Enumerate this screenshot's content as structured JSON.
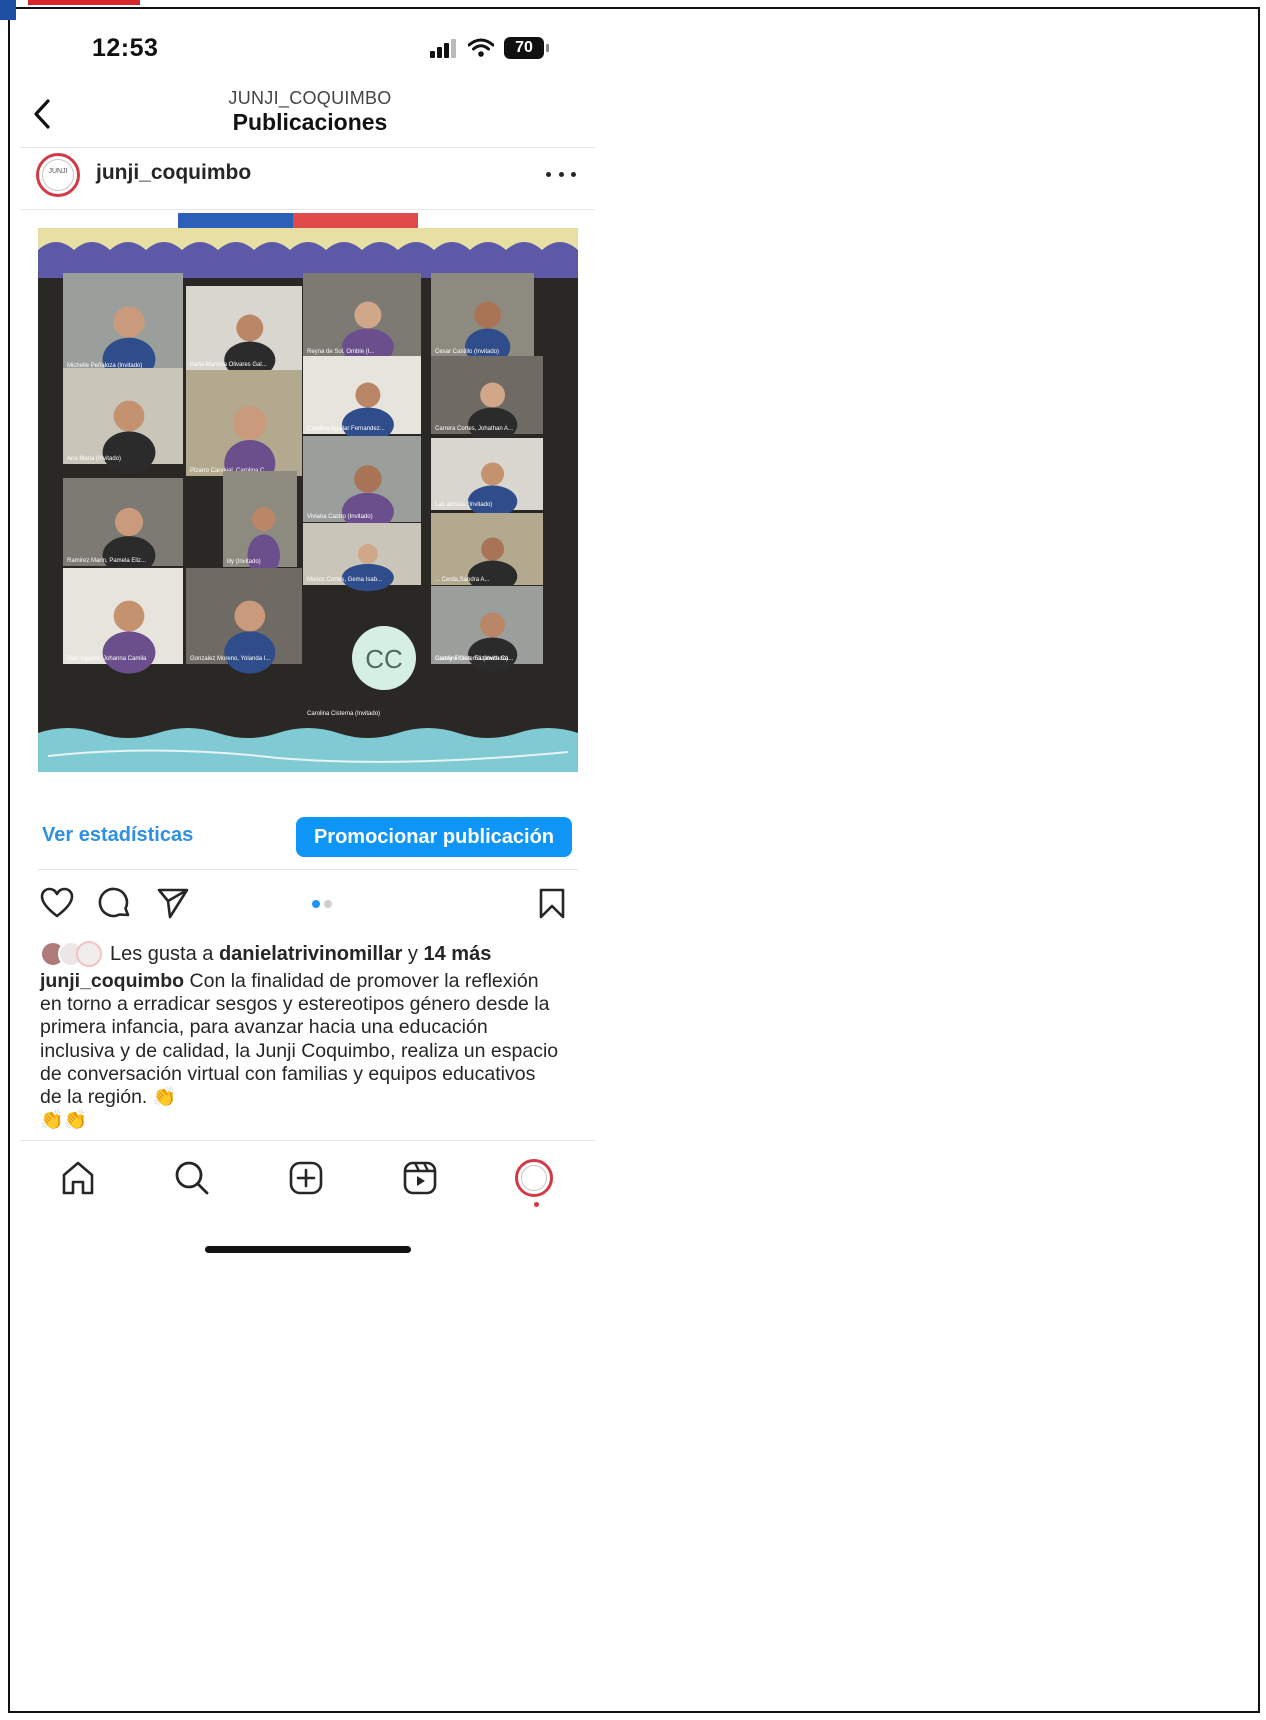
{
  "status_bar": {
    "time": "12:53",
    "battery": "70"
  },
  "header": {
    "account_caps": "JUNJI_COQUIMBO",
    "title": "Publicaciones"
  },
  "post": {
    "avatar_text": "JUNJI",
    "username": "junji_coquimbo",
    "image": {
      "participants": [
        "Michelle Peñaloza (Invitado)",
        "Karla Marcela Olivares Gal...",
        "Reyna de Sol, Omble (I...",
        "Cesar Castillo (Invitado)",
        "Ana Maria (Invitado)",
        "Pizarro Carvajal, Carolina C...",
        "Carolina Aguilar Fernandez...",
        "Carrera Cortes, Johathan A...",
        "Viviana Castro (Invitado)",
        "Las artistas (Invitado)",
        "Ramirez Marin, Pamela Eliz...",
        "lily (Invitado)",
        "Munoz Cortes, Gema Isab...",
        "... Cerda,Sandra A...",
        "Diaz Aguirre, Johanna Camila",
        "Gonzalez Moreno, Yolanda I...",
        "Carolina Cisterna (Invitado)",
        "Godoy Flores, Elizabeth Ca..."
      ],
      "initials_tile": "CC"
    },
    "stats_link": "Ver estadísticas",
    "promote_button": "Promocionar publicación",
    "likes": {
      "prefix": "Les gusta a ",
      "user": "danielatrivinomillar",
      "middle": " y ",
      "count": "14 más"
    },
    "caption": {
      "username": "junji_coquimbo",
      "text": " Con la finalidad de promover la reflexión en torno a erradicar sesgos y estereotipos género desde la primera infancia, para avanzar hacia una educación inclusiva y de calidad, la Junji Coquimbo, realiza un espacio de conversación virtual con familias y equipos educativos de la región.",
      "emoji_1": " 👏",
      "emoji_2": "👏👏"
    },
    "carousel": {
      "current": 1,
      "total": 2
    }
  },
  "bottom_nav": [
    "home-icon",
    "search-icon",
    "new-post-icon",
    "reels-icon",
    "profile-avatar"
  ],
  "colors": {
    "link_blue": "#2f8fe3",
    "button_blue": "#0f95f6",
    "profile_ring": "#d43a45",
    "flag_blue": "#2b5fb8",
    "flag_red": "#e14a4a",
    "image_frame": "#5c5aa8",
    "image_water": "#7fcad3"
  }
}
